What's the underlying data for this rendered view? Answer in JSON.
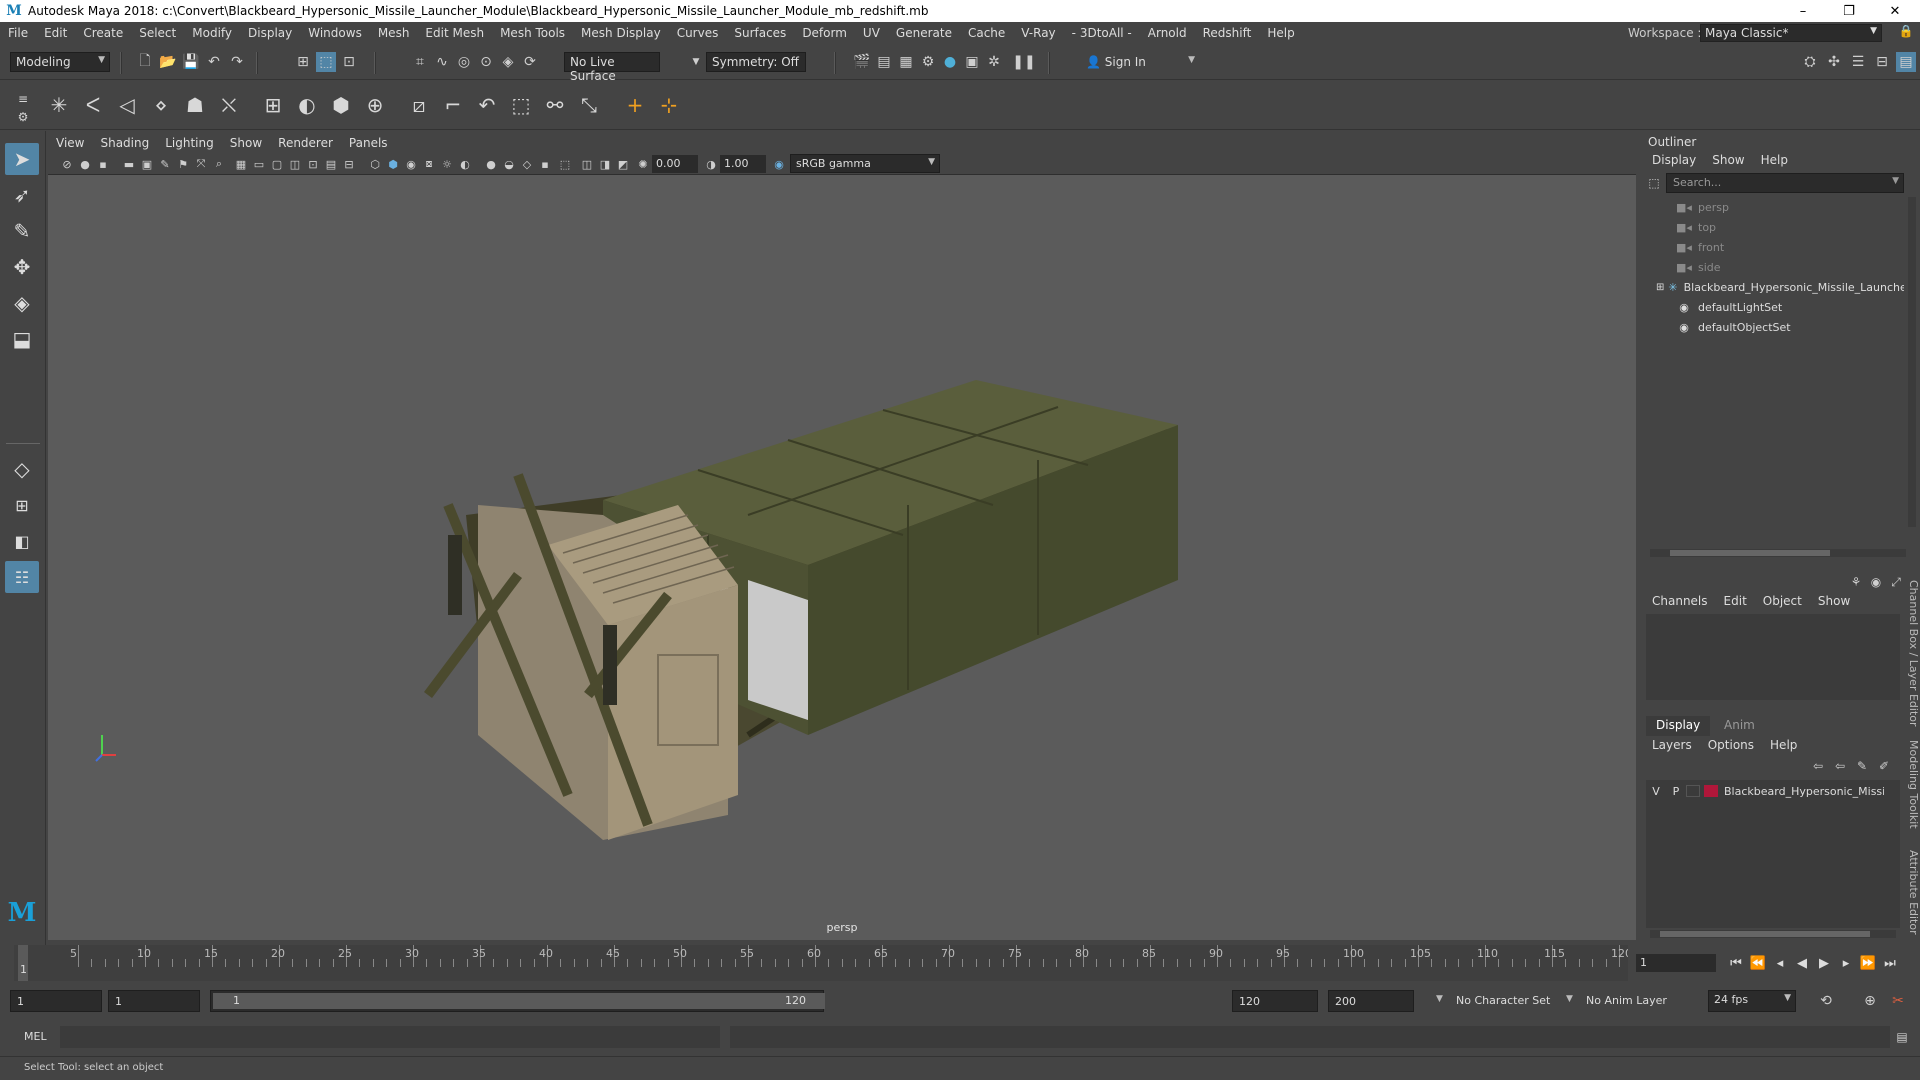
{
  "app": {
    "title": "Autodesk Maya 2018: c:\\Convert\\Blackbeard_Hypersonic_Missile_Launcher_Module\\Blackbeard_Hypersonic_Missile_Launcher_Module_mb_redshift.mb",
    "logo": "M"
  },
  "window_controls": {
    "minimize": "–",
    "maximize": "❐",
    "close": "✕"
  },
  "menu": {
    "items": [
      "File",
      "Edit",
      "Create",
      "Select",
      "Modify",
      "Display",
      "Windows",
      "Mesh",
      "Edit Mesh",
      "Mesh Tools",
      "Mesh Display",
      "Curves",
      "Surfaces",
      "Deform",
      "UV",
      "Generate",
      "Cache",
      "V-Ray",
      "- 3DtoAll -",
      "Arnold",
      "Redshift",
      "Help"
    ],
    "workspace_label": "Workspace :",
    "workspace_value": "Maya Classic*"
  },
  "statusline": {
    "mode": "Modeling",
    "live_surface": "No Live Surface",
    "symmetry": "Symmetry: Off",
    "sign_in": "Sign In"
  },
  "viewport": {
    "menus": [
      "View",
      "Shading",
      "Lighting",
      "Show",
      "Renderer",
      "Panels"
    ],
    "exposure": "0.00",
    "gamma": "1.00",
    "color_space": "sRGB gamma",
    "camera_label": "persp"
  },
  "outliner": {
    "title": "Outliner",
    "menus": [
      "Display",
      "Show",
      "Help"
    ],
    "search_placeholder": "Search...",
    "items": [
      {
        "label": "persp",
        "icon": "camera-icon",
        "dim": true
      },
      {
        "label": "top",
        "icon": "camera-icon",
        "dim": true
      },
      {
        "label": "front",
        "icon": "camera-icon",
        "dim": true
      },
      {
        "label": "side",
        "icon": "camera-icon",
        "dim": true
      },
      {
        "label": "Blackbeard_Hypersonic_Missile_Launcher_Module",
        "icon": "group-icon",
        "dim": false
      },
      {
        "label": "defaultLightSet",
        "icon": "set-icon",
        "dim": false
      },
      {
        "label": "defaultObjectSet",
        "icon": "set-icon",
        "dim": false
      }
    ]
  },
  "channel_box": {
    "menus": [
      "Channels",
      "Edit",
      "Object",
      "Show"
    ]
  },
  "layer_editor": {
    "tabs": [
      "Display",
      "Anim"
    ],
    "menus": [
      "Layers",
      "Options",
      "Help"
    ],
    "layer": {
      "v": "V",
      "p": "P",
      "name": "Blackbeard_Hypersonic_Missile_Launcher_Module",
      "color": "#b0173a"
    }
  },
  "side_tabs": [
    "Channel Box / Layer Editor",
    "Modeling Toolkit",
    "Attribute Editor"
  ],
  "timeline": {
    "ticks": [
      "5",
      "10",
      "15",
      "20",
      "25",
      "30",
      "35",
      "40",
      "45",
      "50",
      "55",
      "60",
      "65",
      "70",
      "75",
      "80",
      "85",
      "90",
      "95",
      "100",
      "105",
      "110",
      "115",
      "120"
    ],
    "current_frame_marker": "1",
    "current_frame": "1"
  },
  "range": {
    "start": "1",
    "playback_start": "1",
    "slider_start": "1",
    "slider_end": "120",
    "playback_end": "120",
    "end": "200",
    "character_set": "No Character Set",
    "anim_layer": "No Anim Layer",
    "fps": "24 fps"
  },
  "command_line": {
    "label": "MEL"
  },
  "help_line": {
    "text": "Select Tool: select an object"
  },
  "colors": {
    "ui_bg": "#444444",
    "viewport_bg": "#5b5b5b",
    "accent": "#5285a6",
    "model_green": "#4e5233",
    "model_tan": "#a99b7f"
  }
}
